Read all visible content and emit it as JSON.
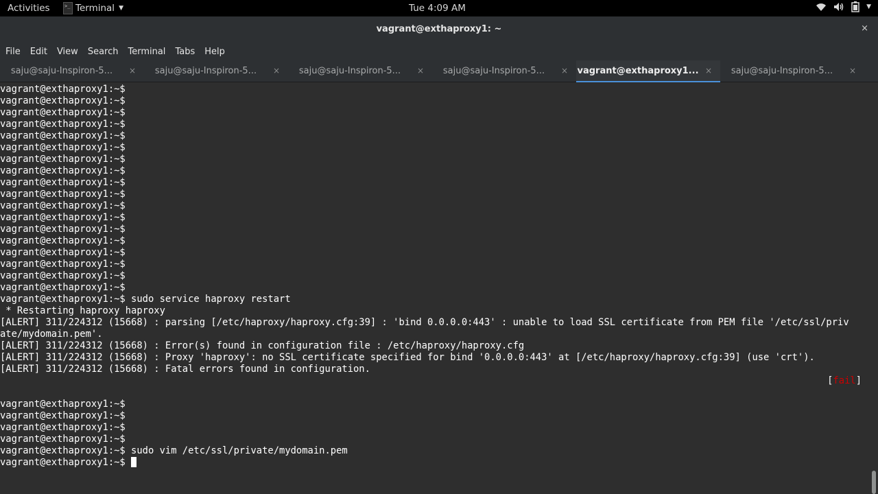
{
  "topbar": {
    "activities": "Activities",
    "app_name": "Terminal",
    "clock": "Tue  4:09 AM",
    "icons": [
      "wifi-icon",
      "volume-icon",
      "battery-icon",
      "system-menu-caret-icon"
    ]
  },
  "window": {
    "title": "vagrant@exthaproxy1: ~",
    "close": "×"
  },
  "menu": {
    "items": [
      "File",
      "Edit",
      "View",
      "Search",
      "Terminal",
      "Tabs",
      "Help"
    ]
  },
  "tabs": [
    {
      "label": "saju@saju-Inspiron-5...",
      "close": "×",
      "active": false
    },
    {
      "label": "saju@saju-Inspiron-5...",
      "close": "×",
      "active": false
    },
    {
      "label": "saju@saju-Inspiron-5...",
      "close": "×",
      "active": false
    },
    {
      "label": "saju@saju-Inspiron-5...",
      "close": "×",
      "active": false
    },
    {
      "label": "vagrant@exthaproxy1...",
      "close": "×",
      "active": true
    },
    {
      "label": "saju@saju-Inspiron-5...",
      "close": "×",
      "active": false
    }
  ],
  "terminal": {
    "prompt": "vagrant@exthaproxy1:~$",
    "lines": [
      "vagrant@exthaproxy1:~$",
      "vagrant@exthaproxy1:~$",
      "vagrant@exthaproxy1:~$",
      "vagrant@exthaproxy1:~$",
      "vagrant@exthaproxy1:~$",
      "vagrant@exthaproxy1:~$",
      "vagrant@exthaproxy1:~$",
      "vagrant@exthaproxy1:~$",
      "vagrant@exthaproxy1:~$",
      "vagrant@exthaproxy1:~$",
      "vagrant@exthaproxy1:~$",
      "vagrant@exthaproxy1:~$",
      "vagrant@exthaproxy1:~$",
      "vagrant@exthaproxy1:~$",
      "vagrant@exthaproxy1:~$",
      "vagrant@exthaproxy1:~$",
      "vagrant@exthaproxy1:~$",
      "vagrant@exthaproxy1:~$",
      "vagrant@exthaproxy1:~$ sudo service haproxy restart",
      " * Restarting haproxy haproxy",
      "[ALERT] 311/224312 (15668) : parsing [/etc/haproxy/haproxy.cfg:39] : 'bind 0.0.0.0:443' : unable to load SSL certificate from PEM file '/etc/ssl/priv",
      "ate/mydomain.pem'.",
      "[ALERT] 311/224312 (15668) : Error(s) found in configuration file : /etc/haproxy/haproxy.cfg",
      "[ALERT] 311/224312 (15668) : Proxy 'haproxy': no SSL certificate specified for bind '0.0.0.0:443' at [/etc/haproxy/haproxy.cfg:39] (use 'crt').",
      "[ALERT] 311/224312 (15668) : Fatal errors found in configuration."
    ],
    "fail_open": "[",
    "fail_word": "fail",
    "fail_close": "]",
    "after_lines": [
      "",
      "vagrant@exthaproxy1:~$",
      "vagrant@exthaproxy1:~$",
      "vagrant@exthaproxy1:~$",
      "vagrant@exthaproxy1:~$",
      "vagrant@exthaproxy1:~$ sudo vim /etc/ssl/private/mydomain.pem"
    ],
    "current_prompt": "vagrant@exthaproxy1:~$ ",
    "fail_color": "#cc0000",
    "background": "#2e2e2e",
    "foreground": "#ffffff"
  }
}
